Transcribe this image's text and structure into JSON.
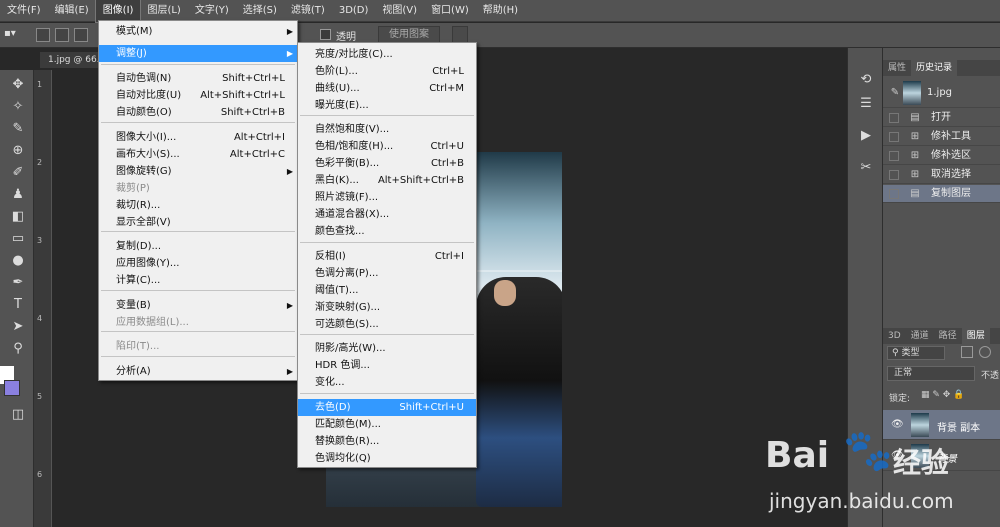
{
  "menubar": {
    "items": [
      "文件(F)",
      "编辑(E)",
      "图像(I)",
      "图层(L)",
      "文字(Y)",
      "选择(S)",
      "滤镜(T)",
      "3D(D)",
      "视图(V)",
      "窗口(W)",
      "帮助(H)"
    ],
    "active_index": 2
  },
  "options_bar": {
    "frag1": "际",
    "transparent_label": "透明",
    "use_pattern_label": "使用图案"
  },
  "document": {
    "tab_label": "1.jpg @ 66.7"
  },
  "ruler": {
    "ticks": [
      "1",
      "2",
      "3",
      "4",
      "5",
      "6"
    ]
  },
  "image_menu": {
    "items": [
      {
        "label": "模式(M)",
        "shortcut": "",
        "submenu": true,
        "disabled": false
      },
      {
        "label": "调整(J)",
        "shortcut": "",
        "submenu": true,
        "disabled": false,
        "highlight": true
      },
      {
        "label": "自动色调(N)",
        "shortcut": "Shift+Ctrl+L",
        "disabled": false
      },
      {
        "label": "自动对比度(U)",
        "shortcut": "Alt+Shift+Ctrl+L",
        "disabled": false
      },
      {
        "label": "自动颜色(O)",
        "shortcut": "Shift+Ctrl+B",
        "disabled": false
      },
      {
        "label": "图像大小(I)...",
        "shortcut": "Alt+Ctrl+I",
        "disabled": false
      },
      {
        "label": "画布大小(S)...",
        "shortcut": "Alt+Ctrl+C",
        "disabled": false
      },
      {
        "label": "图像旋转(G)",
        "shortcut": "",
        "submenu": true,
        "disabled": false
      },
      {
        "label": "裁剪(P)",
        "shortcut": "",
        "disabled": true
      },
      {
        "label": "裁切(R)...",
        "shortcut": "",
        "disabled": false
      },
      {
        "label": "显示全部(V)",
        "shortcut": "",
        "disabled": false
      },
      {
        "label": "复制(D)...",
        "shortcut": "",
        "disabled": false
      },
      {
        "label": "应用图像(Y)...",
        "shortcut": "",
        "disabled": false
      },
      {
        "label": "计算(C)...",
        "shortcut": "",
        "disabled": false
      },
      {
        "label": "变量(B)",
        "shortcut": "",
        "submenu": true,
        "disabled": false
      },
      {
        "label": "应用数据组(L)...",
        "shortcut": "",
        "disabled": true
      },
      {
        "label": "陷印(T)...",
        "shortcut": "",
        "disabled": true
      },
      {
        "label": "分析(A)",
        "shortcut": "",
        "submenu": true,
        "disabled": false
      }
    ]
  },
  "adjust_menu": {
    "items": [
      {
        "label": "亮度/对比度(C)...",
        "shortcut": ""
      },
      {
        "label": "色阶(L)...",
        "shortcut": "Ctrl+L"
      },
      {
        "label": "曲线(U)...",
        "shortcut": "Ctrl+M"
      },
      {
        "label": "曝光度(E)...",
        "shortcut": ""
      },
      {
        "label": "自然饱和度(V)...",
        "shortcut": ""
      },
      {
        "label": "色相/饱和度(H)...",
        "shortcut": "Ctrl+U"
      },
      {
        "label": "色彩平衡(B)...",
        "shortcut": "Ctrl+B"
      },
      {
        "label": "黑白(K)...",
        "shortcut": "Alt+Shift+Ctrl+B"
      },
      {
        "label": "照片滤镜(F)...",
        "shortcut": ""
      },
      {
        "label": "通道混合器(X)...",
        "shortcut": ""
      },
      {
        "label": "颜色查找...",
        "shortcut": ""
      },
      {
        "label": "反相(I)",
        "shortcut": "Ctrl+I"
      },
      {
        "label": "色调分离(P)...",
        "shortcut": ""
      },
      {
        "label": "阈值(T)...",
        "shortcut": ""
      },
      {
        "label": "渐变映射(G)...",
        "shortcut": ""
      },
      {
        "label": "可选颜色(S)...",
        "shortcut": ""
      },
      {
        "label": "阴影/高光(W)...",
        "shortcut": ""
      },
      {
        "label": "HDR 色调...",
        "shortcut": ""
      },
      {
        "label": "变化...",
        "shortcut": ""
      },
      {
        "label": "去色(D)",
        "shortcut": "Shift+Ctrl+U",
        "highlight": true
      },
      {
        "label": "匹配颜色(M)...",
        "shortcut": ""
      },
      {
        "label": "替换颜色(R)...",
        "shortcut": ""
      },
      {
        "label": "色调均化(Q)",
        "shortcut": ""
      }
    ]
  },
  "history_panel": {
    "tabs": [
      "属性",
      "历史记录"
    ],
    "active_tab": 1,
    "snapshot_label": "1.jpg",
    "items": [
      "打开",
      "修补工具",
      "修补选区",
      "取消选择",
      "复制图层"
    ],
    "selected_index": 4
  },
  "layers_panel": {
    "tabs": [
      "3D",
      "通道",
      "路径",
      "图层"
    ],
    "active_tab": 3,
    "filter_label": "类型",
    "blend_mode": "正常",
    "opacity_label": "不透",
    "lock_label": "锁定:",
    "layers": [
      {
        "name": "背景 副本",
        "selected": true
      },
      {
        "name": "背景",
        "selected": false
      }
    ]
  },
  "watermark": {
    "brand": "Bai",
    "brand_cn": "经验",
    "url": "jingyan.baidu.com"
  }
}
